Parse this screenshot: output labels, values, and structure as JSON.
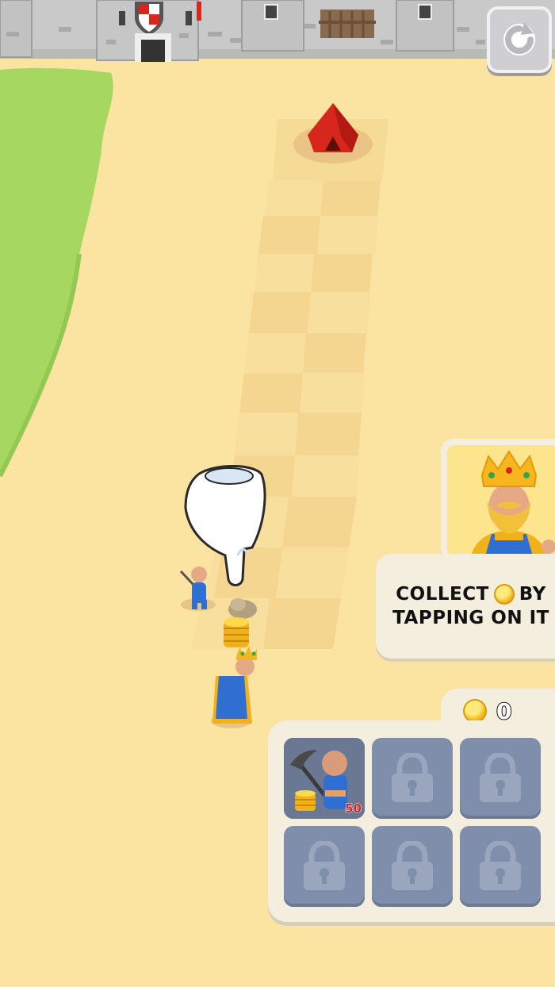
{
  "hud": {
    "restart_icon": "restart-icon",
    "coin_count": "0"
  },
  "hint": {
    "line1_before": "COLLECT",
    "line1_after": "BY",
    "line2": "TAPPING ON IT",
    "portrait_icon": "king-portrait"
  },
  "shop": {
    "slots": [
      {
        "state": "unlocked",
        "unit": "miner",
        "price": "50"
      },
      {
        "state": "locked"
      },
      {
        "state": "locked"
      },
      {
        "state": "locked"
      },
      {
        "state": "locked"
      },
      {
        "state": "locked"
      }
    ]
  },
  "colors": {
    "sand": "#fbe3a1",
    "grass": "#a6d861",
    "castle": "#bfbfbf",
    "panel": "#f4eedf",
    "slot_locked": "#7f8eaa",
    "price_red": "#d3261f",
    "tent_red": "#d7261c"
  }
}
